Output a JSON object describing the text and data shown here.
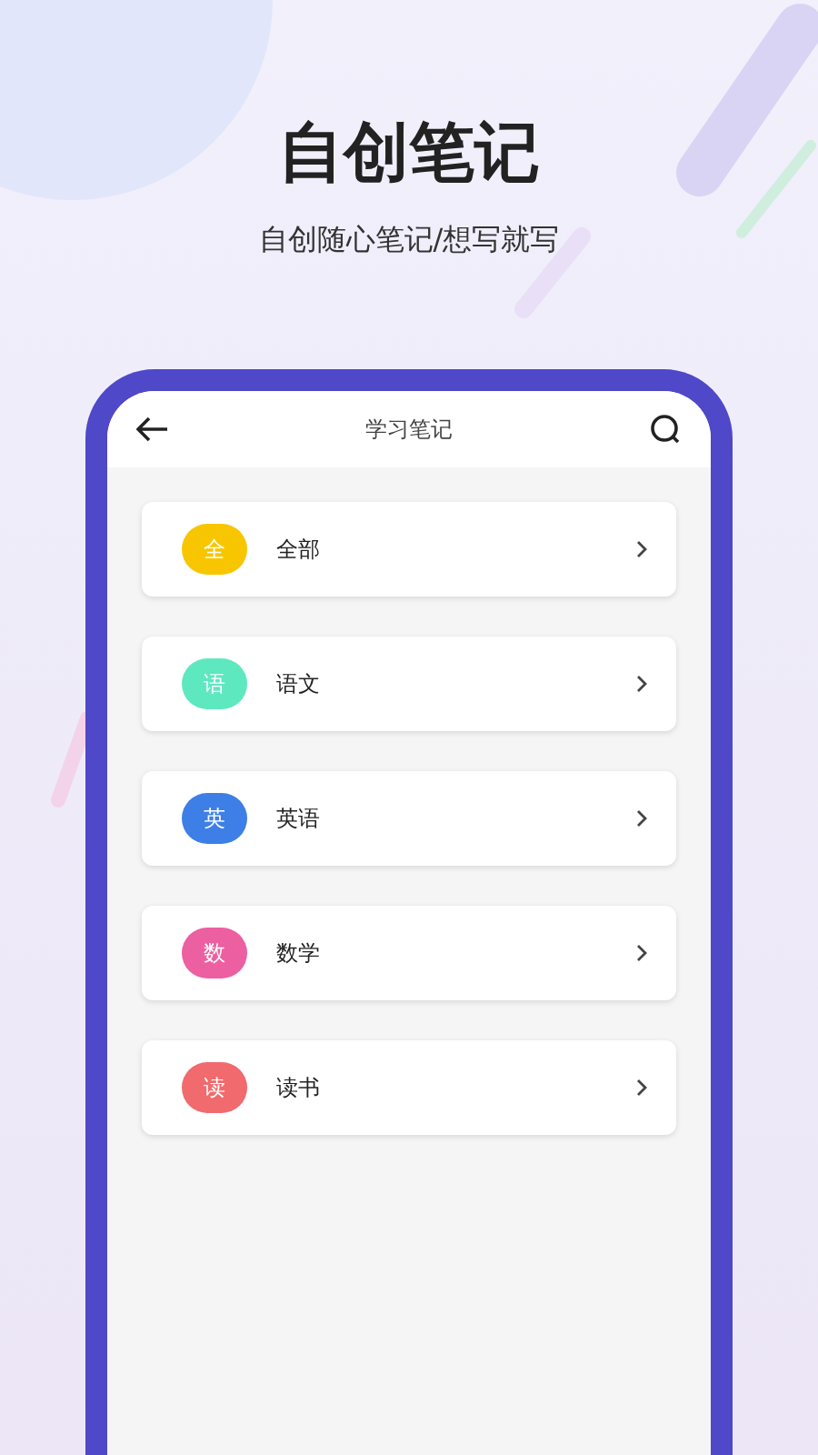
{
  "headline": "自创笔记",
  "subtitle": "自创随心笔记/想写就写",
  "app": {
    "title": "学习笔记",
    "categories": [
      {
        "badge": "全",
        "label": "全部",
        "color": "#f7c600"
      },
      {
        "badge": "语",
        "label": "语文",
        "color": "#5ee8c0"
      },
      {
        "badge": "英",
        "label": "英语",
        "color": "#3d7fe6"
      },
      {
        "badge": "数",
        "label": "数学",
        "color": "#ec5fa0"
      },
      {
        "badge": "读",
        "label": "读书",
        "color": "#f06a6e"
      }
    ]
  }
}
